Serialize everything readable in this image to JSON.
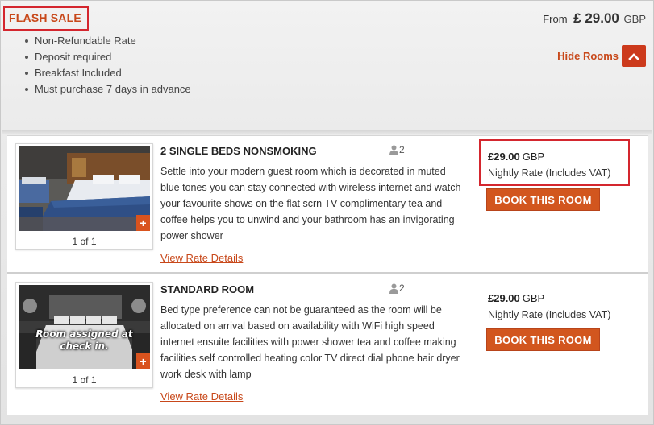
{
  "rate_header": {
    "title": "FLASH SALE",
    "features": [
      "Non-Refundable Rate",
      "Deposit required",
      "Breakfast Included",
      "Must purchase 7 days in advance"
    ],
    "from_label": "From",
    "from_amount": "£ 29.00",
    "from_currency": "GBP",
    "hide_rooms_label": "Hide Rooms",
    "hide_rooms_icon": "chevron-up-icon"
  },
  "rooms": [
    {
      "name": "2 SINGLE BEDS NONSMOKING",
      "occupancy": "2",
      "description": "Settle into your modern guest room which is decorated in muted blue tones you can stay connected with wireless internet and watch your favourite shows on the flat scrn TV complimentary tea and coffee helps you to unwind and your bathroom has an invigorating power shower",
      "photo_count": "1 of 1",
      "photo_caption": "",
      "photo_plus": "+",
      "rate_link": "View Rate Details",
      "price": "£29.00",
      "currency": "GBP",
      "price_note": "Nightly Rate (Includes VAT)",
      "book_label": "BOOK THIS ROOM"
    },
    {
      "name": "STANDARD ROOM",
      "occupancy": "2",
      "description": "Bed type preference can not be guaranteed as the room will be allocated on arrival based on availability with WiFi high speed internet ensuite facilities with power shower tea and coffee making facilities self controlled heating color TV direct dial phone hair dryer work desk with lamp",
      "photo_count": "1 of 1",
      "photo_caption": "Room assigned at check in.",
      "photo_plus": "+",
      "rate_link": "View Rate Details",
      "price": "£29.00",
      "currency": "GBP",
      "price_note": "Nightly Rate (Includes VAT)",
      "book_label": "BOOK THIS ROOM"
    }
  ],
  "colors": {
    "accent_orange": "#d2561e",
    "link_orange": "#c8481a",
    "highlight_red": "#d4262e"
  }
}
